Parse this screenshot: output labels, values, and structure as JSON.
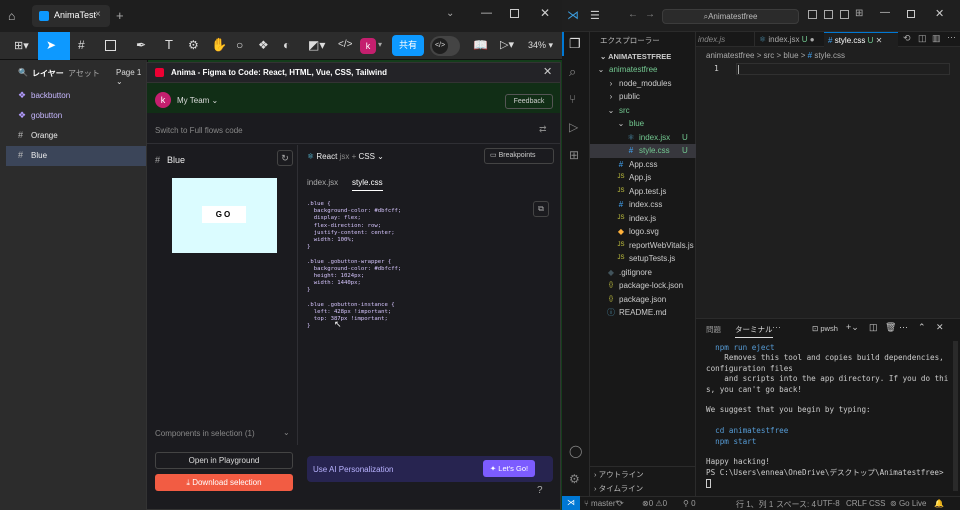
{
  "figma": {
    "tab_title": "AnimaTest",
    "toolbar": {
      "share_label": "共有",
      "zoom": "34%",
      "avatar_letter": "k"
    },
    "layers_panel": {
      "tab_layers": "レイヤー",
      "tab_assets": "アセット",
      "page": "Page 1",
      "items": [
        {
          "label": "backbutton",
          "icon": "component-icon"
        },
        {
          "label": "gobutton",
          "icon": "component-icon"
        },
        {
          "label": "Orange",
          "icon": "frame-icon"
        },
        {
          "label": "Blue",
          "icon": "frame-icon"
        }
      ]
    },
    "plugin": {
      "title": "Anima - Figma to Code: React, HTML, Vue, CSS, Tailwind",
      "team_avatar": "k",
      "team": "My Team",
      "feedback": "Feedback",
      "switch_text": "Switch to Full flows code",
      "frame_name": "Blue",
      "framework": "React",
      "framework_ext": "jsx",
      "style_lang": "CSS",
      "breakpoints": "Breakpoints",
      "preview_button_label": "GO",
      "code_tabs": [
        "index.jsx",
        "style.css"
      ],
      "code": ".blue {\n  background-color: #dbfcff;\n  display: flex;\n  flex-direction: row;\n  justify-content: center;\n  width: 100%;\n}\n\n.blue .gobutton-wrapper {\n  background-color: #dbfcff;\n  height: 1024px;\n  width: 1440px;\n}\n\n.blue .gobutton-instance {\n  left: 428px !important;\n  top: 387px !important;\n}",
      "components": "Components in selection (1)",
      "playground": "Open in Playground",
      "download": "Download selection",
      "personalization": "Use AI Personalization",
      "lets_go": "Let's Go!",
      "help": "?"
    },
    "colors": {
      "accent": "#0d99ff",
      "preview_bg": "#dbfcff",
      "download": "#f25c43",
      "lets_go": "#7c5cff"
    }
  },
  "vscode": {
    "search": "Animatestfree",
    "tabs": [
      {
        "label": "index.js",
        "active": false
      },
      {
        "label": "index.jsx",
        "modifier": "U",
        "active": false
      },
      {
        "label": "style.css",
        "modifier": "U",
        "active": true
      }
    ],
    "breadcrumb": [
      "animatestfree",
      "src",
      "blue",
      "style.css"
    ],
    "line_number": "1",
    "explorer": {
      "header": "エクスプローラー",
      "root": "ANIMATESTFREE",
      "rows": [
        {
          "label": "animatestfree",
          "type": "folder",
          "depth": 0
        },
        {
          "label": "node_modules",
          "type": "folder-closed",
          "depth": 1
        },
        {
          "label": "public",
          "type": "folder-closed",
          "depth": 1
        },
        {
          "label": "src",
          "type": "folder",
          "depth": 1
        },
        {
          "label": "blue",
          "type": "folder",
          "depth": 2
        },
        {
          "label": "index.jsx",
          "type": "jsx",
          "depth": 3,
          "badge": "U"
        },
        {
          "label": "style.css",
          "type": "css",
          "depth": 3,
          "badge": "U"
        },
        {
          "label": "App.css",
          "type": "css",
          "depth": 2
        },
        {
          "label": "App.js",
          "type": "js",
          "depth": 2
        },
        {
          "label": "App.test.js",
          "type": "js",
          "depth": 2
        },
        {
          "label": "index.css",
          "type": "css",
          "depth": 2
        },
        {
          "label": "index.js",
          "type": "js",
          "depth": 2
        },
        {
          "label": "logo.svg",
          "type": "svg",
          "depth": 2
        },
        {
          "label": "reportWebVitals.js",
          "type": "js",
          "depth": 2
        },
        {
          "label": "setupTests.js",
          "type": "js",
          "depth": 2
        },
        {
          "label": ".gitignore",
          "type": "git",
          "depth": 1
        },
        {
          "label": "package-lock.json",
          "type": "json",
          "depth": 1
        },
        {
          "label": "package.json",
          "type": "json",
          "depth": 1
        },
        {
          "label": "README.md",
          "type": "md",
          "depth": 1
        }
      ],
      "outline": "アウトライン",
      "timeline": "タイムライン"
    },
    "terminal": {
      "tabs": [
        "問題",
        "ターミナル"
      ],
      "shell": "pwsh",
      "lines": [
        "  npm run eject",
        "    Removes this tool and copies build dependencies, configuration files",
        "    and scripts into the app directory. If you do this, you can't go back!",
        "",
        "We suggest that you begin by typing:",
        "",
        "  cd animatestfree",
        "  npm start",
        "",
        "Happy hacking!",
        "PS C:\\Users\\ennea\\OneDrive\\デスクトップ\\Animatestfree> "
      ]
    },
    "status": {
      "branch": "master*",
      "errors": "0",
      "warnings": "0",
      "ports": "0",
      "position": "行 1、列 1",
      "spaces": "スペース: 4",
      "encoding": "UTF-8",
      "eol": "CRLF",
      "lang": "CSS",
      "live": "Go Live"
    }
  }
}
